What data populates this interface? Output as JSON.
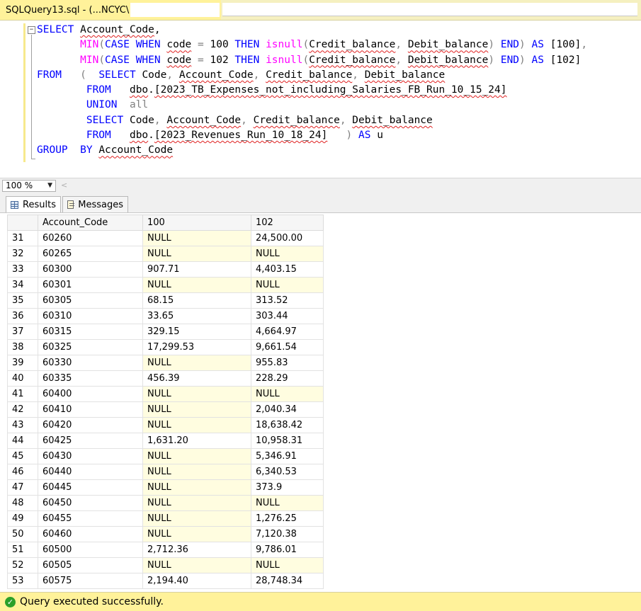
{
  "window": {
    "tab_title": "SQLQuery13.sql - (...NCYC\\"
  },
  "editor": {
    "lines": [
      [
        {
          "t": "SELECT",
          "c": "kw"
        },
        {
          "t": " "
        },
        {
          "t": "Account_Code",
          "c": "sq"
        },
        {
          "t": ","
        }
      ],
      [
        {
          "t": "       "
        },
        {
          "t": "MIN",
          "c": "fn"
        },
        {
          "t": "(",
          "c": "gr"
        },
        {
          "t": "CASE",
          "c": "kw"
        },
        {
          "t": " "
        },
        {
          "t": "WHEN",
          "c": "kw"
        },
        {
          "t": " "
        },
        {
          "t": "code",
          "c": "sq"
        },
        {
          "t": " = ",
          "c": "gr"
        },
        {
          "t": "100 "
        },
        {
          "t": "THEN",
          "c": "kw"
        },
        {
          "t": " "
        },
        {
          "t": "isnull",
          "c": "fn"
        },
        {
          "t": "(",
          "c": "gr"
        },
        {
          "t": "Credit_balance",
          "c": "sq"
        },
        {
          "t": ", ",
          "c": "gr"
        },
        {
          "t": "Debit_balance",
          "c": "sq"
        },
        {
          "t": ")",
          "c": "gr"
        },
        {
          "t": " "
        },
        {
          "t": "END",
          "c": "kw"
        },
        {
          "t": ")",
          "c": "gr"
        },
        {
          "t": " "
        },
        {
          "t": "AS",
          "c": "kw"
        },
        {
          "t": " [100]"
        },
        {
          "t": ",",
          "c": "gr"
        }
      ],
      [
        {
          "t": "       "
        },
        {
          "t": "MIN",
          "c": "fn"
        },
        {
          "t": "(",
          "c": "gr"
        },
        {
          "t": "CASE",
          "c": "kw"
        },
        {
          "t": " "
        },
        {
          "t": "WHEN",
          "c": "kw"
        },
        {
          "t": " "
        },
        {
          "t": "code",
          "c": "sq"
        },
        {
          "t": " = ",
          "c": "gr"
        },
        {
          "t": "102 "
        },
        {
          "t": "THEN",
          "c": "kw"
        },
        {
          "t": " "
        },
        {
          "t": "isnull",
          "c": "fn"
        },
        {
          "t": "(",
          "c": "gr"
        },
        {
          "t": "Credit_balance",
          "c": "sq"
        },
        {
          "t": ", ",
          "c": "gr"
        },
        {
          "t": "Debit_balance",
          "c": "sq"
        },
        {
          "t": ")",
          "c": "gr"
        },
        {
          "t": " "
        },
        {
          "t": "END",
          "c": "kw"
        },
        {
          "t": ")",
          "c": "gr"
        },
        {
          "t": " "
        },
        {
          "t": "AS",
          "c": "kw"
        },
        {
          "t": " [102]"
        }
      ],
      [
        {
          "t": "FROM",
          "c": "kw"
        },
        {
          "t": "   "
        },
        {
          "t": "(",
          "c": "gr"
        },
        {
          "t": "  "
        },
        {
          "t": "SELECT",
          "c": "kw"
        },
        {
          "t": " Code"
        },
        {
          "t": ", ",
          "c": "gr"
        },
        {
          "t": "Account_Code",
          "c": "sq"
        },
        {
          "t": ", ",
          "c": "gr"
        },
        {
          "t": "Credit_balance",
          "c": "sq"
        },
        {
          "t": ", ",
          "c": "gr"
        },
        {
          "t": "Debit_balance",
          "c": "sq"
        }
      ],
      [
        {
          "t": "        "
        },
        {
          "t": "FROM",
          "c": "kw"
        },
        {
          "t": "   "
        },
        {
          "t": "dbo",
          "c": "sq"
        },
        {
          "t": "."
        },
        {
          "t": "[2023_TB_Expenses_not_including_Salaries_FB_Run_10_15_24]",
          "c": "sq"
        }
      ],
      [
        {
          "t": "        "
        },
        {
          "t": "UNION",
          "c": "kw"
        },
        {
          "t": "  "
        },
        {
          "t": "all",
          "c": "gr"
        }
      ],
      [
        {
          "t": "        "
        },
        {
          "t": "SELECT",
          "c": "kw"
        },
        {
          "t": " Code"
        },
        {
          "t": ", ",
          "c": "gr"
        },
        {
          "t": "Account_Code",
          "c": "sq"
        },
        {
          "t": ", ",
          "c": "gr"
        },
        {
          "t": "Credit_balance",
          "c": "sq"
        },
        {
          "t": ", ",
          "c": "gr"
        },
        {
          "t": "Debit_balance",
          "c": "sq"
        }
      ],
      [
        {
          "t": "        "
        },
        {
          "t": "FROM",
          "c": "kw"
        },
        {
          "t": "   "
        },
        {
          "t": "dbo",
          "c": "sq"
        },
        {
          "t": "."
        },
        {
          "t": "[2023_Revenues_Run_10_18_24]",
          "c": "sq"
        },
        {
          "t": "   "
        },
        {
          "t": ")",
          "c": "gr"
        },
        {
          "t": " "
        },
        {
          "t": "AS",
          "c": "kw"
        },
        {
          "t": " u"
        }
      ],
      [
        {
          "t": "GROUP",
          "c": "kw"
        },
        {
          "t": "  "
        },
        {
          "t": "BY",
          "c": "kw"
        },
        {
          "t": " "
        },
        {
          "t": "Account_Code",
          "c": "sq"
        }
      ]
    ]
  },
  "zoom": {
    "value": "100 %"
  },
  "results": {
    "tab_results": "Results",
    "tab_messages": "Messages",
    "columns": [
      "Account_Code",
      "100",
      "102"
    ],
    "rows": [
      [
        "31",
        "60260",
        "NULL",
        "24,500.00"
      ],
      [
        "32",
        "60265",
        "NULL",
        "NULL"
      ],
      [
        "33",
        "60300",
        "907.71",
        "4,403.15"
      ],
      [
        "34",
        "60301",
        "NULL",
        "NULL"
      ],
      [
        "35",
        "60305",
        "68.15",
        "313.52"
      ],
      [
        "36",
        "60310",
        "33.65",
        "303.44"
      ],
      [
        "37",
        "60315",
        "329.15",
        "4,664.97"
      ],
      [
        "38",
        "60325",
        "17,299.53",
        "9,661.54"
      ],
      [
        "39",
        "60330",
        "NULL",
        "955.83"
      ],
      [
        "40",
        "60335",
        "456.39",
        "228.29"
      ],
      [
        "41",
        "60400",
        "NULL",
        "NULL"
      ],
      [
        "42",
        "60410",
        "NULL",
        "2,040.34"
      ],
      [
        "43",
        "60420",
        "NULL",
        "18,638.42"
      ],
      [
        "44",
        "60425",
        "1,631.20",
        "10,958.31"
      ],
      [
        "45",
        "60430",
        "NULL",
        "5,346.91"
      ],
      [
        "46",
        "60440",
        "NULL",
        "6,340.53"
      ],
      [
        "47",
        "60445",
        "NULL",
        "373.9"
      ],
      [
        "48",
        "60450",
        "NULL",
        "NULL"
      ],
      [
        "49",
        "60455",
        "NULL",
        "1,276.25"
      ],
      [
        "50",
        "60460",
        "NULL",
        "7,120.38"
      ],
      [
        "51",
        "60500",
        "2,712.36",
        "9,786.01"
      ],
      [
        "52",
        "60505",
        "NULL",
        "NULL"
      ],
      [
        "53",
        "60575",
        "2,194.40",
        "28,748.34"
      ]
    ]
  },
  "status": {
    "message": "Query executed successfully.",
    "icon": "success-check-icon",
    "color": "#fff29a"
  },
  "colors": {
    "keyword": "#0000ff",
    "function": "#ff00ff",
    "operator": "#808080",
    "null_cell": "#fffde0"
  }
}
